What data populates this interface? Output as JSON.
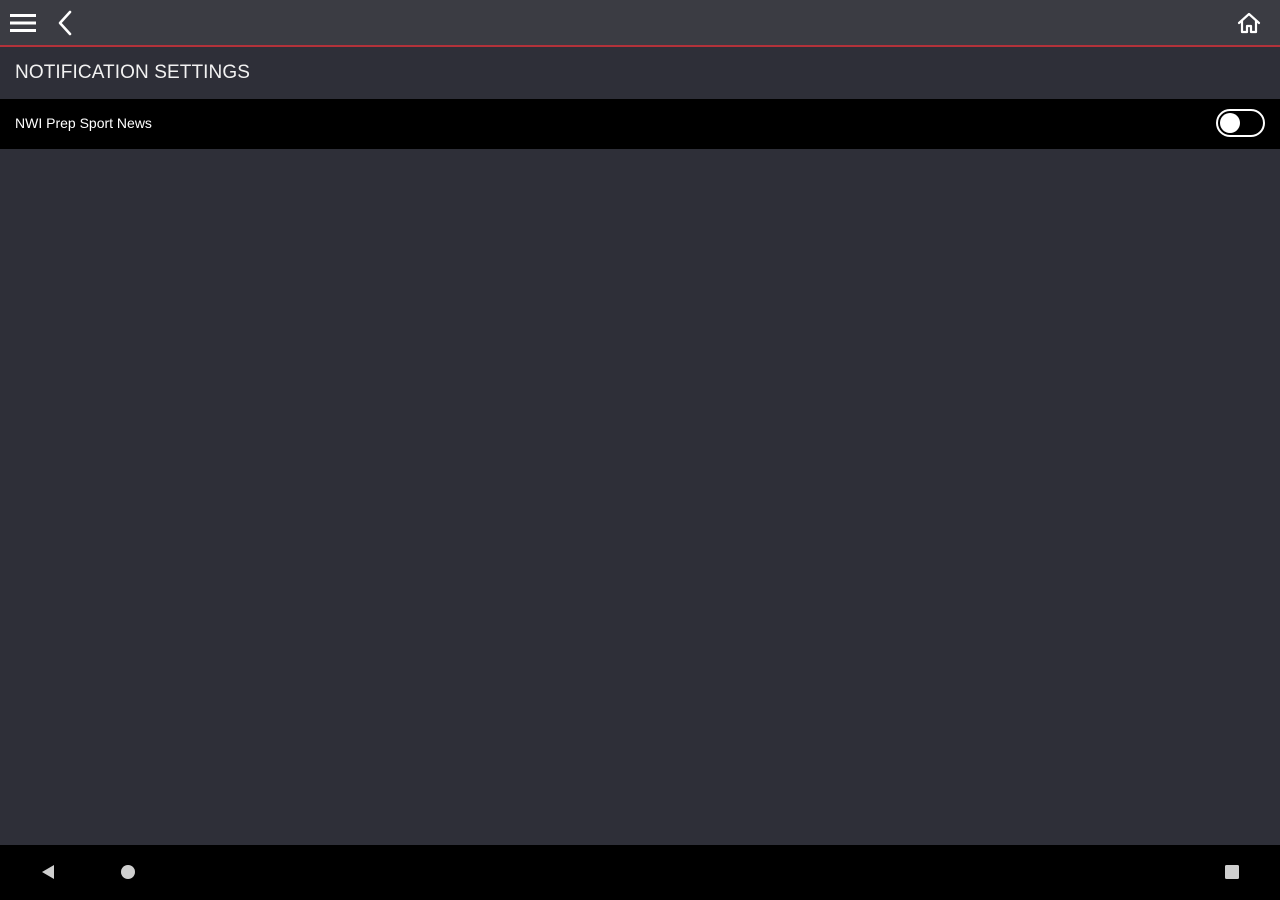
{
  "header": {
    "icons": {
      "menu": "hamburger-menu-icon",
      "back": "chevron-left-icon",
      "home": "home-icon"
    },
    "accent_color": "#b3323a"
  },
  "section": {
    "title": "NOTIFICATION SETTINGS"
  },
  "settings": [
    {
      "label": "NWI Prep Sport News",
      "enabled": false
    }
  ],
  "system_nav": {
    "icons": {
      "back": "triangle-back-icon",
      "home": "circle-home-icon",
      "recents": "square-recents-icon"
    }
  }
}
